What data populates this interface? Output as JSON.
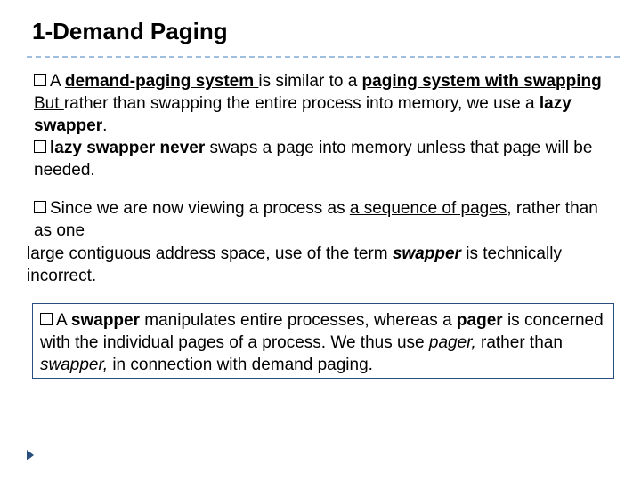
{
  "title": "1-Demand Paging",
  "p1": {
    "a": "A ",
    "b": "demand-paging system ",
    "c": "is similar to a ",
    "d": "paging system with swapping ",
    "e": "But ",
    "f": " rather than swapping the entire process into memory,  we use a ",
    "g": "lazy swapper",
    "h": "."
  },
  "p2": {
    "a": "lazy swapper never ",
    "b": "swaps a page into memory unless that page will be needed."
  },
  "p3": {
    "a": "Since we are now viewing a process as ",
    "b": "a sequence of pages,",
    "c": " rather than as one"
  },
  "p3b": {
    "a": "large contiguous address space, use of the term ",
    "b": "swapper",
    "c": " is technically incorrect."
  },
  "p4": {
    "a": "A ",
    "b": "swapper ",
    "c": "manipulates entire processes,  whereas a ",
    "d": "pager",
    "e": " is concerned with the individual pages of a process. We thus use ",
    "f": "pager,",
    "g": " rather than ",
    "h": "swapper,",
    "i": " in connection with demand paging."
  }
}
